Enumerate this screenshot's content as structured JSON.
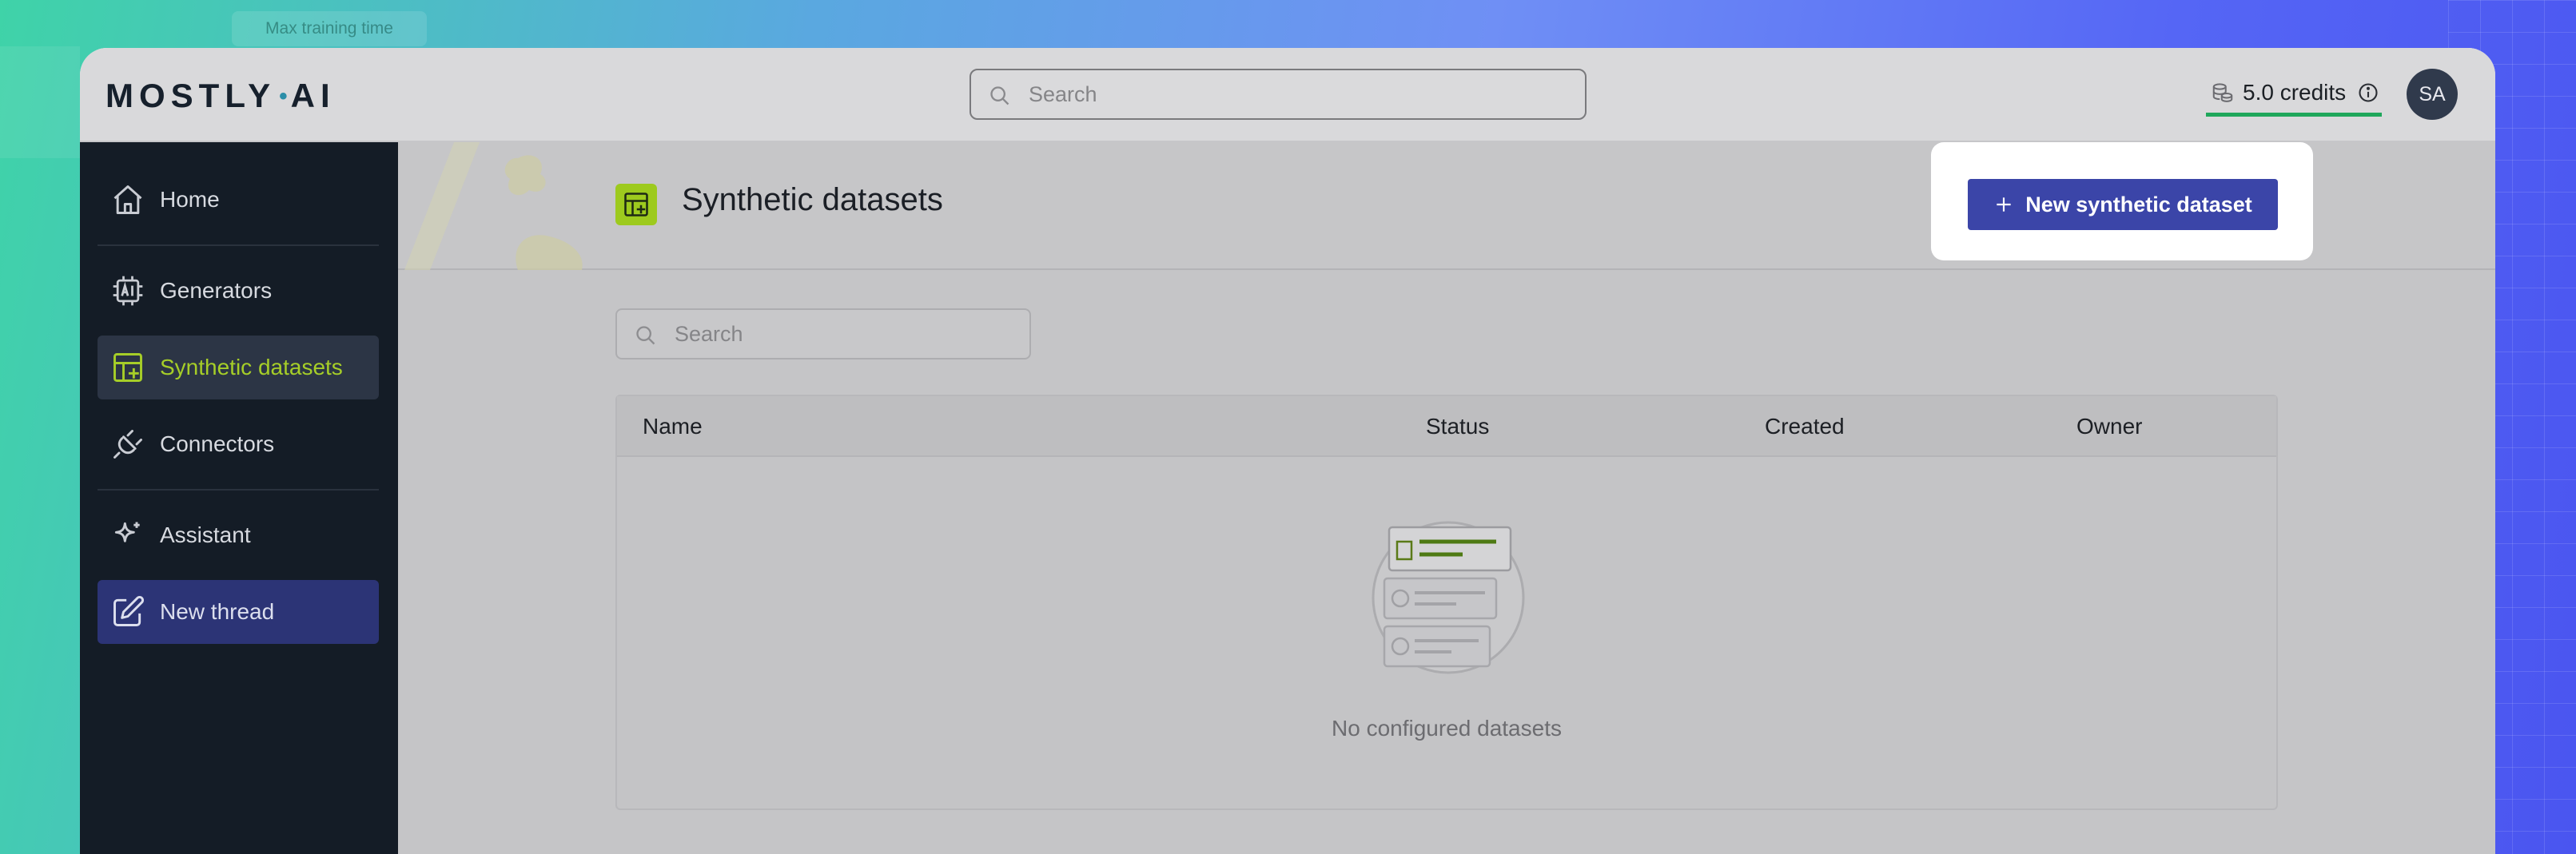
{
  "background": {
    "hint_label": "Max training time"
  },
  "header": {
    "logo": {
      "left": "MOSTLY",
      "dot": "•",
      "right": "AI"
    },
    "search": {
      "placeholder": "Search",
      "value": ""
    },
    "credits": {
      "label": "5.0 credits"
    },
    "avatar": {
      "initials": "SA"
    }
  },
  "sidebar": {
    "items": [
      {
        "label": "Home",
        "icon": "home-icon"
      },
      {
        "label": "Generators",
        "icon": "ai-chip-icon"
      },
      {
        "label": "Synthetic datasets",
        "icon": "table-plus-icon",
        "active": true
      },
      {
        "label": "Connectors",
        "icon": "plug-icon"
      },
      {
        "label": "Assistant",
        "icon": "sparkle-icon"
      },
      {
        "label": "New thread",
        "icon": "edit-icon"
      }
    ]
  },
  "main": {
    "title": "Synthetic datasets",
    "new_button_label": "New synthetic dataset",
    "search": {
      "placeholder": "Search",
      "value": ""
    },
    "table": {
      "columns": [
        "Name",
        "Status",
        "Created",
        "Owner"
      ],
      "rows": [],
      "empty_text": "No configured datasets"
    }
  },
  "colors": {
    "accent_green": "#a6ce28",
    "primary_button": "#3b45a8",
    "sidebar_bg": "#141c26",
    "credits_underline": "#1fa75b"
  }
}
